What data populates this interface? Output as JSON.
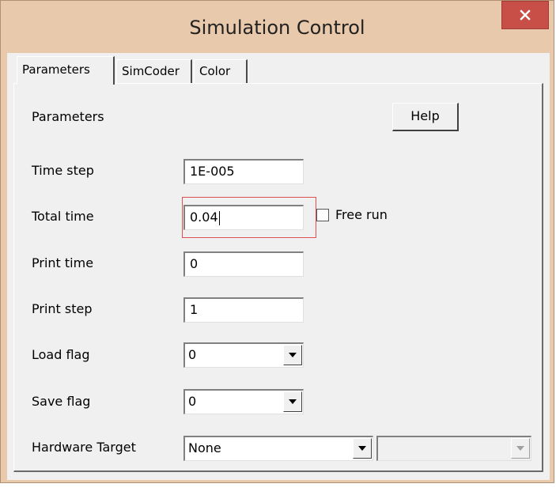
{
  "window": {
    "title": "Simulation Control",
    "accent_close_color": "#c84f47"
  },
  "tabs": [
    {
      "label": "Parameters",
      "active": true
    },
    {
      "label": "SimCoder",
      "active": false
    },
    {
      "label": "Color",
      "active": false
    }
  ],
  "panel": {
    "heading": "Parameters",
    "help_label": "Help",
    "time_step": {
      "label": "Time step",
      "value": "1E-005"
    },
    "total_time": {
      "label": "Total time",
      "value": "0.04"
    },
    "free_run": {
      "label": "Free run",
      "checked": false
    },
    "print_time": {
      "label": "Print time",
      "value": "0"
    },
    "print_step": {
      "label": "Print step",
      "value": "1"
    },
    "load_flag": {
      "label": "Load flag",
      "value": "0"
    },
    "save_flag": {
      "label": "Save flag",
      "value": "0"
    },
    "hardware_target": {
      "label": "Hardware Target",
      "value": "None",
      "secondary_value": ""
    }
  },
  "icons": {
    "close": "close-icon",
    "dropdown": "chevron-down-icon"
  }
}
